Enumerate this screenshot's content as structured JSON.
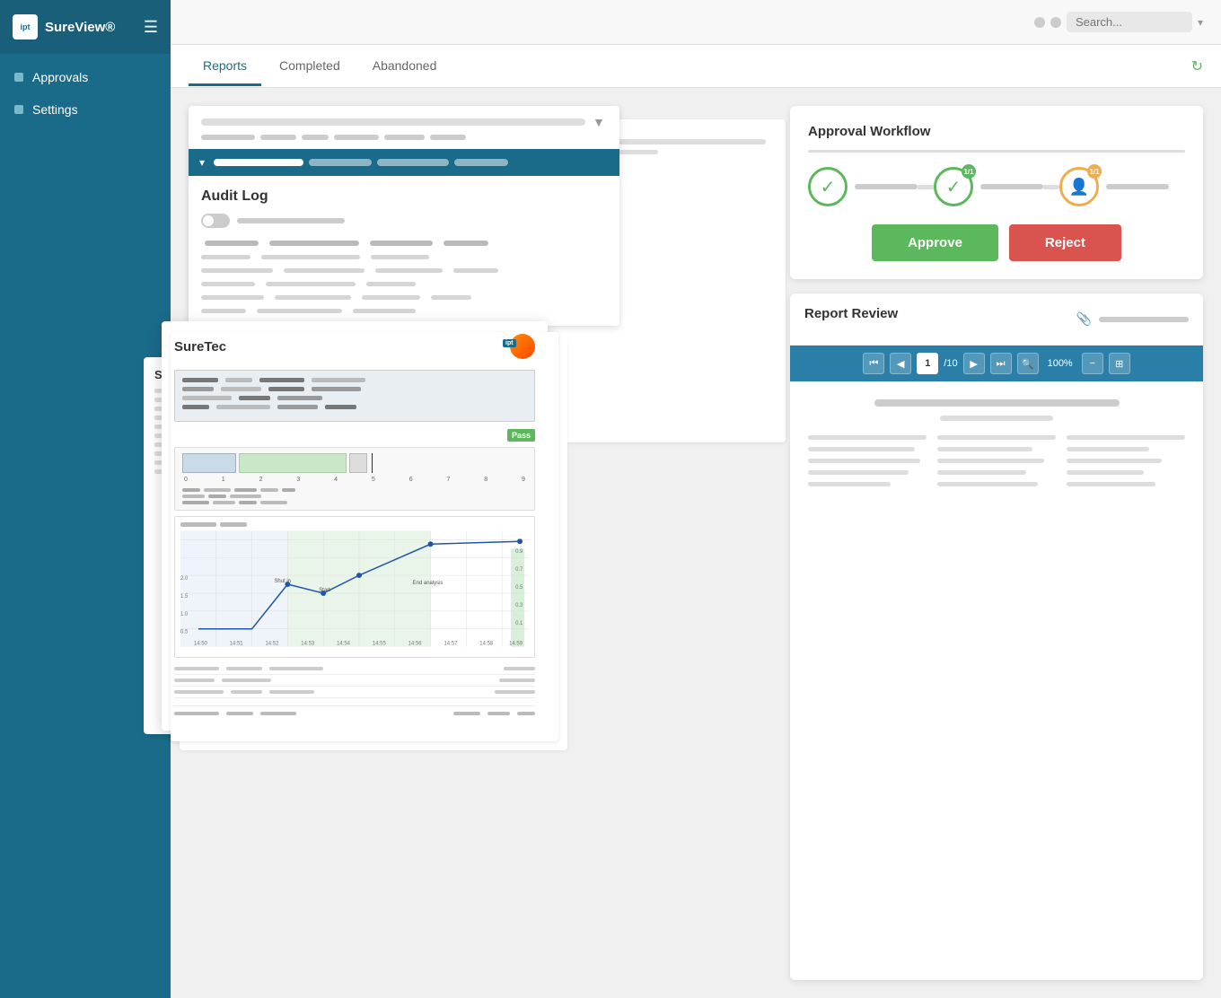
{
  "sidebar": {
    "brand": "SureView®",
    "logo_text": "ipt",
    "items": [
      {
        "id": "approvals",
        "label": "Approvals"
      },
      {
        "id": "settings",
        "label": "Settings"
      }
    ]
  },
  "topbar": {
    "search_placeholder": "Search..."
  },
  "tabs": [
    {
      "id": "reports",
      "label": "Reports",
      "active": true
    },
    {
      "id": "completed",
      "label": "Completed",
      "active": false
    },
    {
      "id": "abandoned",
      "label": "Abandoned",
      "active": false
    }
  ],
  "audit_log": {
    "title": "Audit Log"
  },
  "approval_workflow": {
    "title": "Approval Workflow",
    "steps": [
      {
        "type": "check",
        "badge": null
      },
      {
        "type": "check",
        "badge": "1/1"
      },
      {
        "type": "user",
        "badge": "1/1"
      }
    ],
    "approve_label": "Approve",
    "reject_label": "Reject"
  },
  "report_review": {
    "title": "Report Review",
    "page_current": "1",
    "page_total": "/10",
    "zoom": "100%",
    "toolbar_buttons": [
      "⏮",
      "◀",
      "▶",
      "⏭",
      "🔍",
      "⊞"
    ]
  },
  "suretec": {
    "brand": "SureTec",
    "pass_label": "Pass"
  }
}
